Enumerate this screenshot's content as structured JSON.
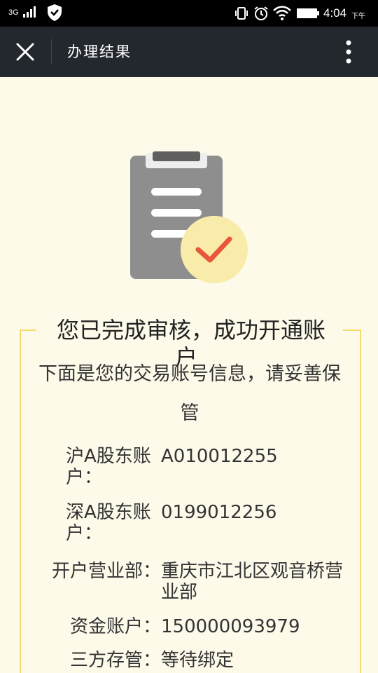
{
  "status_bar": {
    "network": "3G",
    "time": "4:04",
    "ampm": "下午"
  },
  "nav": {
    "title": "办理结果"
  },
  "result": {
    "headline_line1": "您已完成审核，成功开通账",
    "headline_line2": "户",
    "subtitle": "下面是您的交易账号信息，请妥善保管"
  },
  "accounts": [
    {
      "label": "沪A股东账户：",
      "value": "A010012255"
    },
    {
      "label": "深A股东账户：",
      "value": "0199012256"
    },
    {
      "label": "开户营业部：",
      "value": "重庆市江北区观音桥营业部"
    },
    {
      "label": "资金账户：",
      "value": "150000093979"
    },
    {
      "label": "三方存管：",
      "value": "等待绑定"
    }
  ],
  "colors": {
    "nav_bg": "#23282e",
    "page_bg": "#fdfaea",
    "accent_yellow": "#f5dc6a",
    "check_red": "#e8573a",
    "clipboard_gray": "#8e8e8e"
  }
}
